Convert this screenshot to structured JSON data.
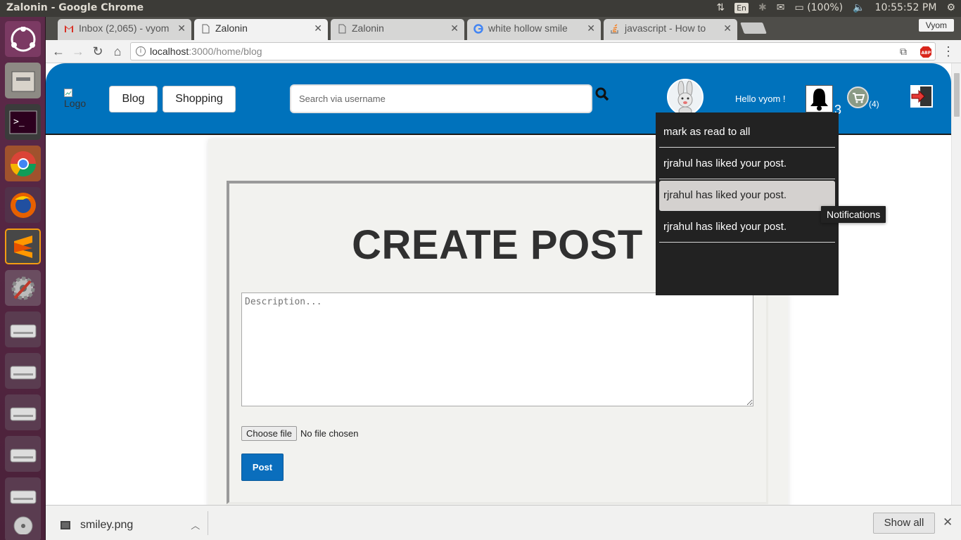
{
  "os": {
    "window_title": "Zalonin - Google Chrome",
    "keyboard": "En",
    "battery": "(100%)",
    "clock": "10:55:52 PM"
  },
  "browser": {
    "tabs": [
      {
        "label": "Inbox (2,065) - vyom",
        "icon": "gmail-icon"
      },
      {
        "label": "Zalonin",
        "icon": "page-icon"
      },
      {
        "label": "Zalonin",
        "icon": "page-icon"
      },
      {
        "label": "white hollow smile",
        "icon": "google-icon"
      },
      {
        "label": "javascript - How to",
        "icon": "stackoverflow-icon"
      }
    ],
    "active_tab": 1,
    "profile": "Vyom",
    "url_host": "localhost",
    "url_path": ":3000/home/blog"
  },
  "header": {
    "logo_alt": "Logo",
    "nav": [
      "Blog",
      "Shopping"
    ],
    "search_placeholder": "Search via username",
    "greeting": "Hello vyom !",
    "notification_count": "3",
    "cart_count": "(4)"
  },
  "notifications": {
    "mark_all": "mark as read to all",
    "items": [
      "rjrahul has liked your post.",
      "rjrahul has liked your post.",
      "rjrahul has liked your post."
    ],
    "tooltip": "Notifications"
  },
  "form": {
    "title": "CREATE POST",
    "description_placeholder": "Description...",
    "file_button": "Choose file",
    "file_status": "No file chosen",
    "submit": "Post"
  },
  "downloads": {
    "file": "smiley.png",
    "show_all": "Show all"
  },
  "colors": {
    "header_blue": "#0072bc",
    "post_button": "#0a6ebd",
    "dropdown_bg": "#222222"
  }
}
